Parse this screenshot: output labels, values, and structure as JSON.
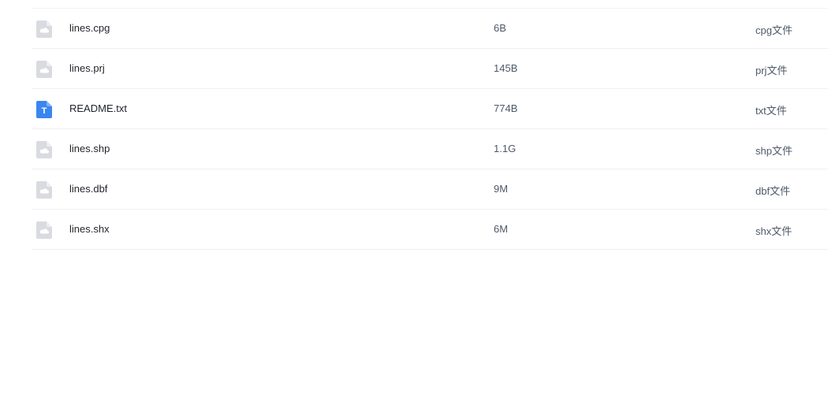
{
  "files": [
    {
      "name": "lines.cpg",
      "size": "6B",
      "type": "cpg文件",
      "icon": "generic-file-icon"
    },
    {
      "name": "lines.prj",
      "size": "145B",
      "type": "prj文件",
      "icon": "generic-file-icon"
    },
    {
      "name": "README.txt",
      "size": "774B",
      "type": "txt文件",
      "icon": "text-file-icon"
    },
    {
      "name": "lines.shp",
      "size": "1.1G",
      "type": "shp文件",
      "icon": "generic-file-icon"
    },
    {
      "name": "lines.dbf",
      "size": "9M",
      "type": "dbf文件",
      "icon": "generic-file-icon"
    },
    {
      "name": "lines.shx",
      "size": "6M",
      "type": "shx文件",
      "icon": "generic-file-icon"
    }
  ],
  "icon_text_letter": "T",
  "colors": {
    "generic_icon": "#d9dbe0",
    "text_icon": "#3a86f0",
    "name_text": "#1f2329",
    "meta_text": "#4e5969",
    "divider": "#eef0f2"
  }
}
